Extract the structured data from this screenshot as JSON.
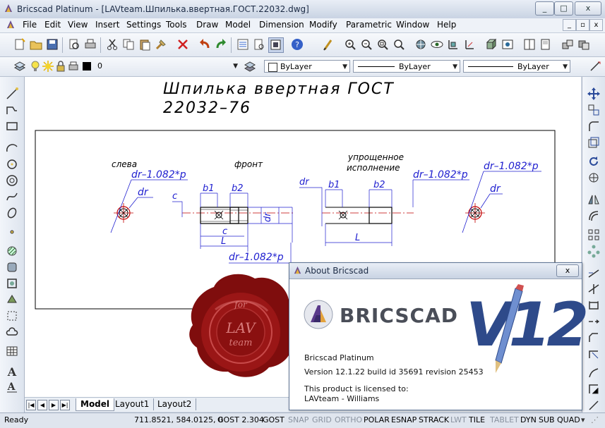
{
  "window": {
    "title": "Bricscad Platinum - [LAVteam.Шпилька.ввертная.ГОСТ.22032.dwg]",
    "controls": [
      "_",
      "□",
      "x"
    ]
  },
  "menu": [
    "File",
    "Edit",
    "View",
    "Insert",
    "Settings",
    "Tools",
    "Draw",
    "Model",
    "Dimension",
    "Modify",
    "Parametric",
    "Window",
    "Help"
  ],
  "mdi_controls": [
    "_",
    "▫",
    "x"
  ],
  "layer_bar": {
    "layer_value": "0",
    "color_value": "ByLayer",
    "linetype_value": "ByLayer",
    "lineweight_value": "ByLayer"
  },
  "drawing": {
    "title_line1": "Шпилька ввертная ГОСТ",
    "title_line2": "22032–76",
    "labels": {
      "left": "слева",
      "front": "фронт",
      "simplified_1": "упрощенное",
      "simplified_2": "исполнение",
      "dr_formula": "dr–1.082*p",
      "dr": "dr",
      "b1": "b1",
      "b2": "b2",
      "c": "c",
      "L": "L"
    }
  },
  "seal": {
    "text_top": "LAV",
    "text_bottom": "team",
    "ring": "for"
  },
  "tabs": [
    "Model",
    "Layout1",
    "Layout2"
  ],
  "active_tab": "Model",
  "status": {
    "ready": "Ready",
    "coords": "711.8521, 584.0125, 0",
    "gost": "GOST 2.304",
    "toggles": [
      {
        "label": "GOST",
        "on": true
      },
      {
        "label": "SNAP",
        "on": false
      },
      {
        "label": "GRID",
        "on": false
      },
      {
        "label": "ORTHO",
        "on": false
      },
      {
        "label": "POLAR",
        "on": true
      },
      {
        "label": "ESNAP",
        "on": true
      },
      {
        "label": "STRACK",
        "on": true
      },
      {
        "label": "LWT",
        "on": false
      },
      {
        "label": "TILE",
        "on": true
      },
      {
        "label": "TABLET",
        "on": false
      },
      {
        "label": "DYN",
        "on": true
      },
      {
        "label": "SUB",
        "on": true
      },
      {
        "label": "QUAD",
        "on": true
      }
    ]
  },
  "about": {
    "title": "About Bricscad",
    "close": "x",
    "brand": "BRICSCAD",
    "version_logo": "V12",
    "product": "Bricscad Platinum",
    "version": "Version 12.1.22 build id 35691 revision 25453",
    "license_label": "This product is licensed to:",
    "licensee": "LAVteam - Williams"
  },
  "colors": {
    "accent": "#3a4a8c",
    "seal": "#8b1010",
    "dim_blue": "#2020d0",
    "cad_red": "#c00000"
  }
}
